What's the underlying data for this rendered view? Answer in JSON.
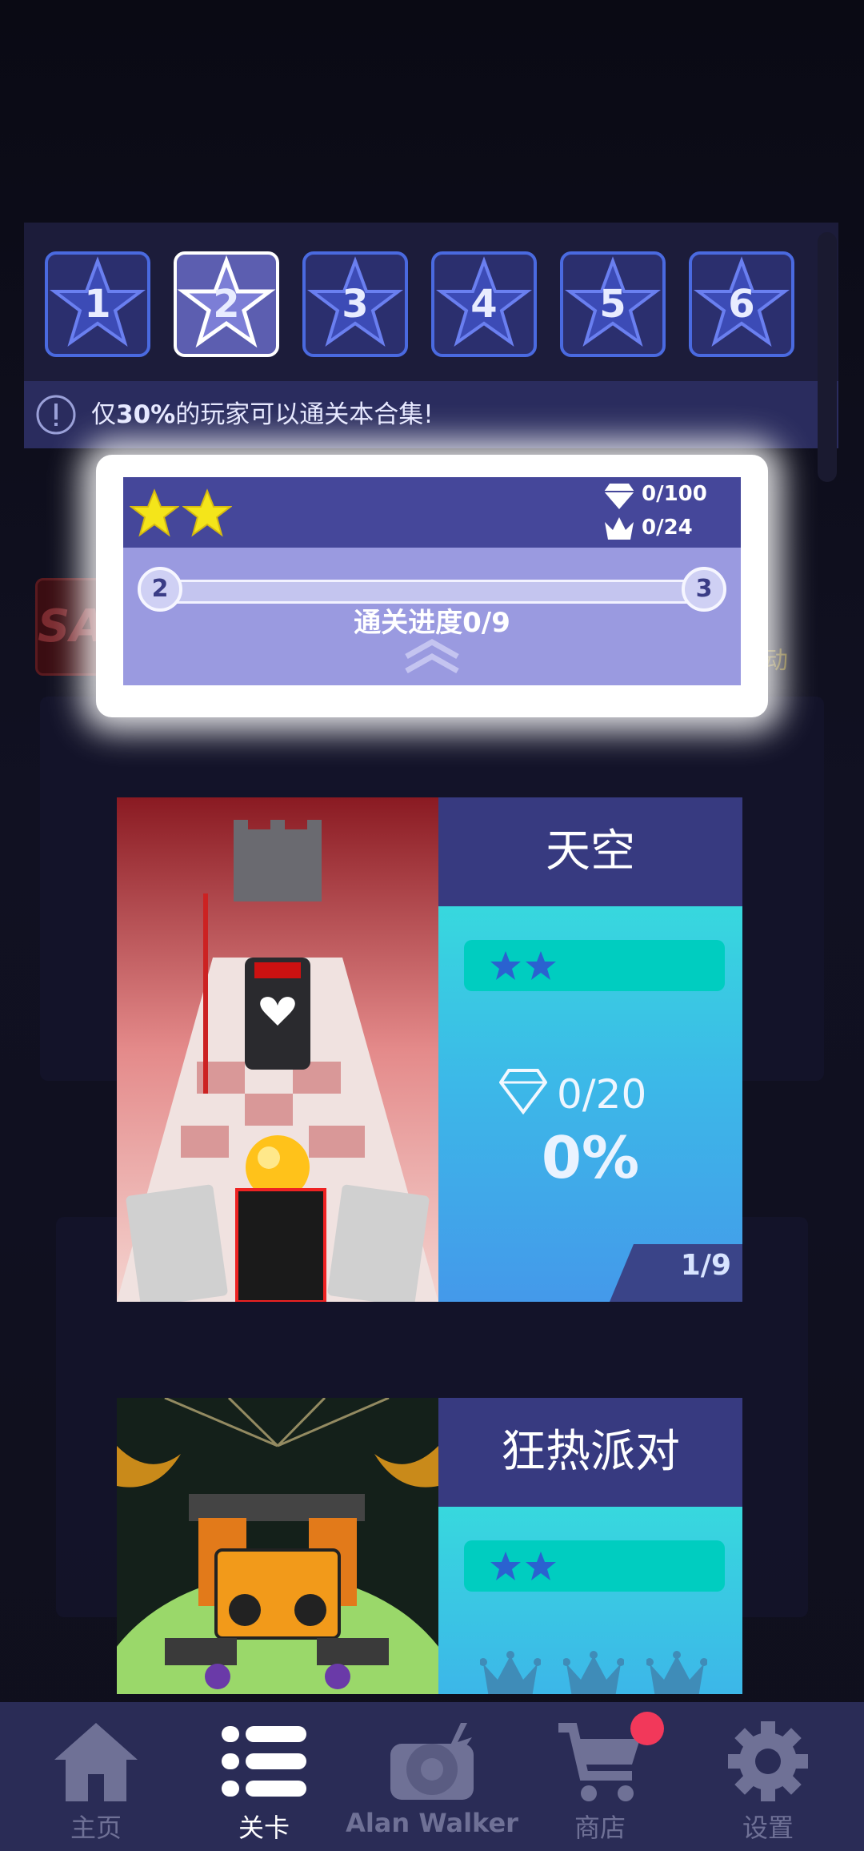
{
  "packs": {
    "items": [
      "1",
      "2",
      "3",
      "4",
      "5",
      "6"
    ],
    "selected_index": 1,
    "notice_prefix": "仅",
    "notice_highlight": "30%",
    "notice_suffix": "的玩家可以通关本合集!"
  },
  "pack_progress": {
    "stars": 2,
    "diamonds": "0/100",
    "crowns": "0/24",
    "bar_start": "2",
    "bar_end": "3",
    "bar_fraction": 0,
    "progress_label": "通关进度",
    "progress_value": "0/9"
  },
  "background": {
    "sale_text": "SAL",
    "event_text": "活动"
  },
  "levels": [
    {
      "title": "天空",
      "stars": 2,
      "diamonds": "0/20",
      "percent": "0%",
      "index": "1/9"
    },
    {
      "title": "狂热派对",
      "stars": 2,
      "crowns": 3
    }
  ],
  "nav": {
    "home": "主页",
    "levels": "关卡",
    "alan_walker": "Alan Walker",
    "shop": "商店",
    "settings": "设置",
    "active": "levels"
  },
  "colors": {
    "accent_yellow": "#ffd63a",
    "panel": "#1c1c3a",
    "nav_bg": "#2a2c56",
    "notification": "#f2385a"
  }
}
